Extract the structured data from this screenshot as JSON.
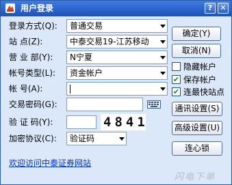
{
  "window": {
    "title": "用户登录",
    "help_glyph": "?",
    "close_glyph": "✕",
    "icon_name": "app-logo-icon"
  },
  "form": {
    "login_method": {
      "label": "登录方式(Q):",
      "value": "普通交易"
    },
    "site": {
      "label": "站    点(Z):",
      "value": "中泰交易19-江苏移动"
    },
    "branch": {
      "label": "营 业 部(Y):",
      "value": "N宁夏"
    },
    "account_type": {
      "label": "帐号类型(L):",
      "value": "资金帐户"
    },
    "account": {
      "label": "帐      号(A):",
      "value": ""
    },
    "trade_password": {
      "label": "交易密码(G):",
      "value": ""
    },
    "verify_code": {
      "label": "验 证 码(Y):",
      "value": "",
      "captcha": "4841"
    },
    "encryption": {
      "label": "加密协议(C):",
      "value": "验证码"
    }
  },
  "buttons": {
    "confirm": "确定(Y)",
    "cancel": "取消(N)",
    "comm_settings": "通讯设置(S)",
    "advanced_settings": "高级设置(U)",
    "connect": "连心锁"
  },
  "checkboxes": {
    "hide_account": {
      "label": "隐藏帐户",
      "checked": false
    },
    "save_account": {
      "label": "保存帐户",
      "checked": true
    },
    "fastest_site": {
      "label": "连最快站点",
      "checked": true
    }
  },
  "footer": {
    "welcome_link": "欢迎访问中泰证券网站",
    "watermark": "闪电下单"
  },
  "colors": {
    "titlebar": "#1d53b9",
    "background": "#dbe8f9",
    "link": "#0033cc",
    "checkmark": "#16872f"
  }
}
